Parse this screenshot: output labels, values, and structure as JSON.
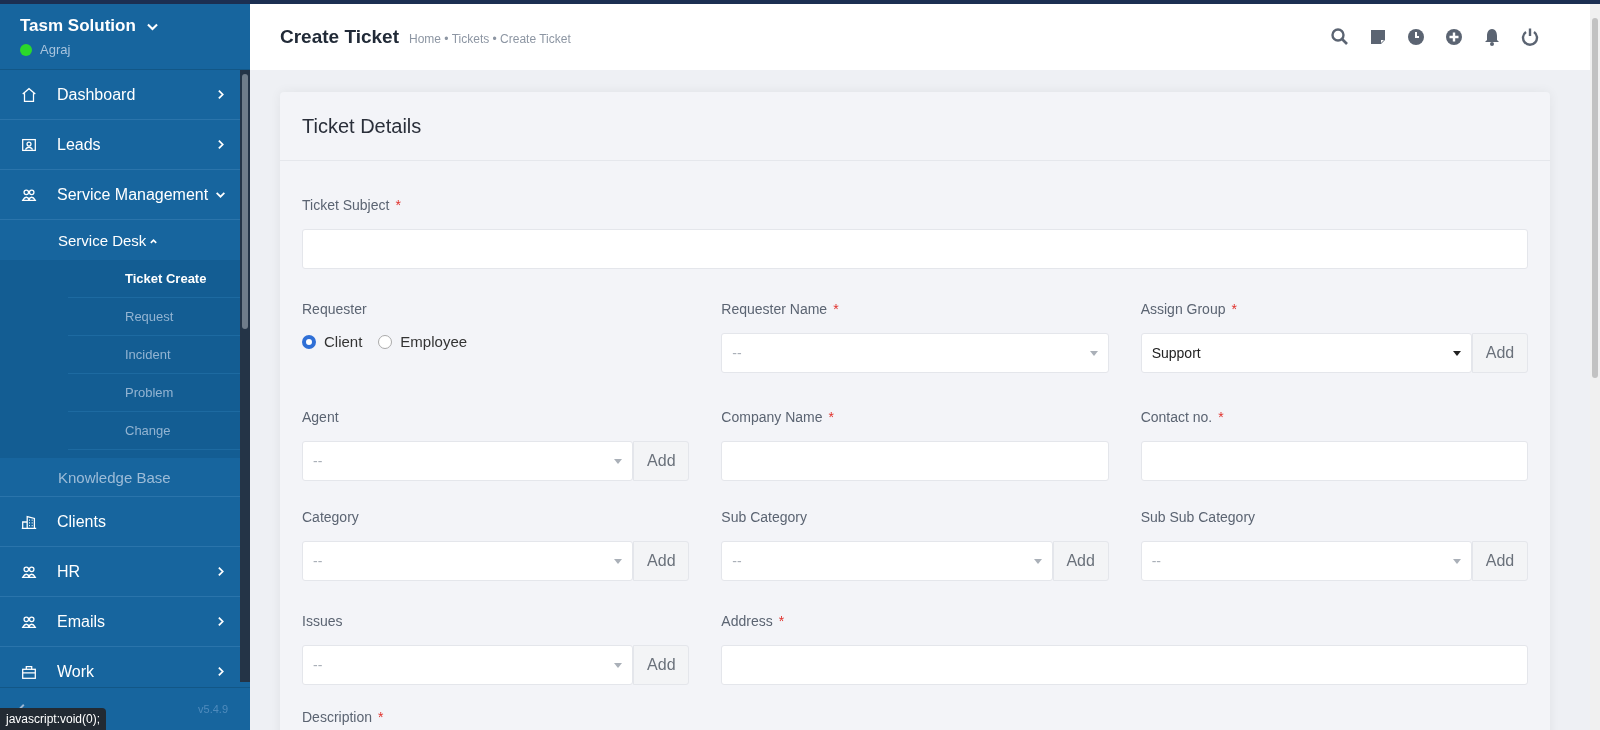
{
  "sidebar": {
    "company": "Tasm Solution",
    "user": "Agraj",
    "online": true,
    "items": [
      {
        "label": "Dashboard",
        "expanded": false
      },
      {
        "label": "Leads",
        "expanded": false
      },
      {
        "label": "Service Management",
        "expanded": true,
        "children": [
          {
            "label": "Service Desk",
            "expanded": true,
            "children": [
              {
                "label": "Ticket Create",
                "selected": true
              },
              {
                "label": "Request",
                "selected": false
              },
              {
                "label": "Incident",
                "selected": false
              },
              {
                "label": "Problem",
                "selected": false
              },
              {
                "label": "Change",
                "selected": false
              }
            ]
          },
          {
            "label": "Knowledge Base"
          }
        ]
      },
      {
        "label": "Clients"
      },
      {
        "label": "HR",
        "expanded": false
      },
      {
        "label": "Emails",
        "expanded": false
      },
      {
        "label": "Work",
        "expanded": false
      }
    ],
    "version": "v5.4.9"
  },
  "status_link": "javascript:void(0);",
  "header": {
    "title": "Create Ticket",
    "breadcrumb": "Home • Tickets • Create Ticket"
  },
  "card": {
    "title": "Ticket Details",
    "rows": [
      [
        {
          "kind": "text",
          "label": "Ticket Subject",
          "required_mark": "*"
        }
      ],
      [
        {
          "kind": "radio",
          "label": "Requester",
          "options": [
            {
              "label": "Client",
              "selected": true
            },
            {
              "label": "Employee",
              "selected": false
            }
          ]
        },
        {
          "kind": "select",
          "label": "Requester Name",
          "required_mark": "*",
          "placeholder": "--"
        },
        {
          "kind": "select",
          "label": "Assign Group",
          "required_mark": "*",
          "value": "Support",
          "add": "Add"
        }
      ],
      [
        {
          "kind": "select",
          "label": "Agent",
          "placeholder": "--",
          "add": "Add"
        },
        {
          "kind": "text",
          "label": "Company Name",
          "required_mark": "*"
        },
        {
          "kind": "text",
          "label": "Contact no.",
          "required_mark": "*"
        }
      ],
      [
        {
          "kind": "select",
          "label": "Category",
          "placeholder": "--",
          "add": "Add"
        },
        {
          "kind": "select",
          "label": "Sub Category",
          "placeholder": "--",
          "add": "Add"
        },
        {
          "kind": "select",
          "label": "Sub Sub Category",
          "placeholder": "--",
          "add": "Add"
        }
      ],
      [
        {
          "kind": "select",
          "label": "Issues",
          "placeholder": "--",
          "add": "Add"
        },
        {
          "kind": "text",
          "label": "Address",
          "required_mark": "*"
        }
      ],
      [
        {
          "kind": "label",
          "label": "Description",
          "required_mark": "*"
        }
      ]
    ]
  }
}
